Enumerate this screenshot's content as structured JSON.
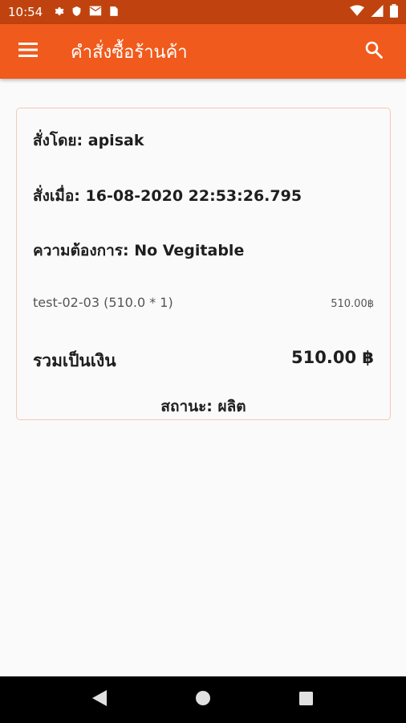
{
  "status_bar": {
    "time": "10:54",
    "icons_left": [
      "gear-icon",
      "shield-icon",
      "mail-icon",
      "sim-icon"
    ],
    "icons_right": [
      "wifi-icon",
      "signal-icon",
      "battery-icon"
    ]
  },
  "app_bar": {
    "title": "คำสั่งซื้อร้านค้า",
    "color": "#f05a1c"
  },
  "order": {
    "ordered_by": "สั่งโดย: apisak",
    "ordered_at": "สั่งเมื่อ: 16-08-2020 22:53:26.795",
    "requirement": "ความต้องการ: No Vegitable",
    "items": [
      {
        "name": "test-02-03  (510.0 * 1)",
        "price": "510.00฿"
      }
    ],
    "total_label": "รวมเป็นเงิน",
    "total_value": "510.00 ฿",
    "status": "สถานะ: ผลิต"
  },
  "nav_bar": {
    "buttons": [
      "back-icon",
      "home-icon",
      "recents-icon"
    ]
  }
}
